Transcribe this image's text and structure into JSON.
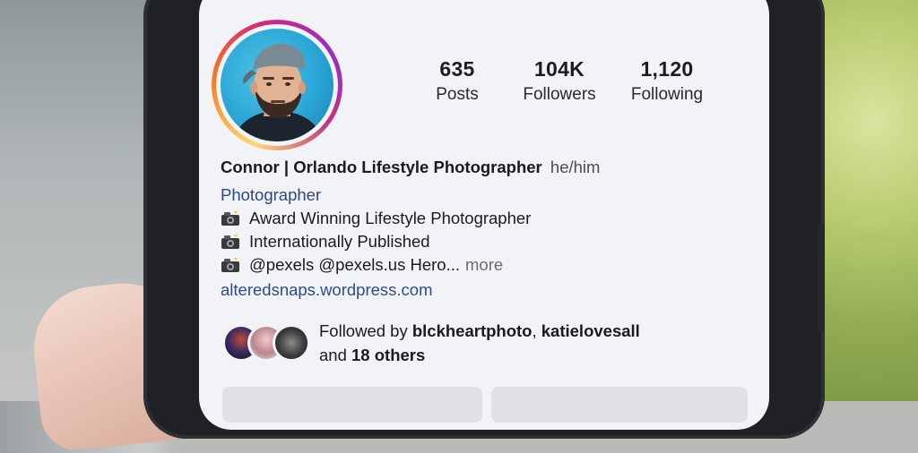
{
  "profile": {
    "stats": {
      "posts": {
        "value": "635",
        "label": "Posts"
      },
      "followers": {
        "value": "104K",
        "label": "Followers"
      },
      "following": {
        "value": "1,120",
        "label": "Following"
      }
    },
    "name": "Connor | Orlando Lifestyle Photographer",
    "pronouns": "he/him",
    "category": "Photographer",
    "bio_lines": [
      "Award Winning Lifestyle Photographer",
      "Internationally Published",
      "@pexels @pexels.us Hero..."
    ],
    "more_label": "more",
    "link": "alteredsnaps.wordpress.com",
    "bio_icon": "camera-with-flash-icon"
  },
  "followed_by": {
    "prefix": "Followed by",
    "user1": "blckheartphoto",
    "separator": ",",
    "user2": "katielovesall",
    "and": "and",
    "others": "18 others"
  },
  "colors": {
    "link": "#2f4d86",
    "category": "#30467c",
    "screen_bg": "#f2f3f7",
    "ring": [
      "#feda75",
      "#fa7e1e",
      "#d62976",
      "#962fbf"
    ]
  }
}
